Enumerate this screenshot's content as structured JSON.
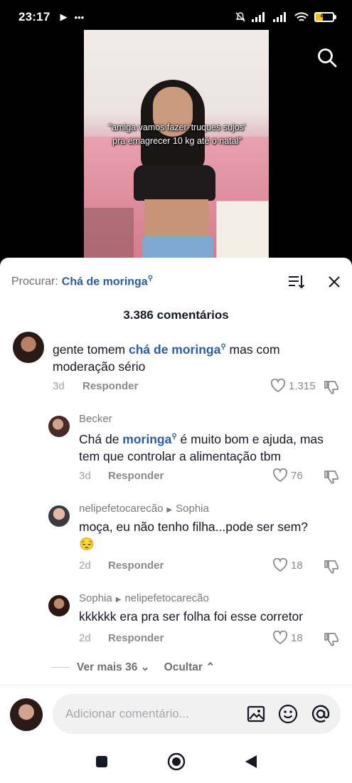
{
  "status_bar": {
    "time": "23:17",
    "left_icons": [
      "play-icon",
      "more-dots-icon"
    ],
    "battery_level": "42",
    "battery_fraction": 0.42,
    "accent": "#f2c200"
  },
  "video": {
    "caption": "\"amiga vamos fazer 'truques sujos' pra emagrecer 10 kg até o natal\""
  },
  "sheet": {
    "search_prefix": "Procurar:",
    "search_term": "Chá de moringa",
    "comment_count": "3.386 comentários"
  },
  "comments": [
    {
      "username": "",
      "text_before": "gente tomem ",
      "link": "chá de moringa",
      "text_after": " mas com moderação sério",
      "age": "3d",
      "reply": "Responder",
      "likes": "1.315"
    },
    {
      "username": "Becker",
      "text_before": "Chá de ",
      "link": "moringa",
      "text_after": " é muito bom e ajuda, mas tem que controlar a alimentação tbm",
      "age": "3d",
      "reply": "Responder",
      "likes": "76"
    },
    {
      "username": "nelipefetocarecão",
      "reply_to": "Sophia",
      "text": "moça, eu não tenho filha...pode ser sem?",
      "emoji": "😔",
      "age": "2d",
      "reply": "Responder",
      "likes": "18"
    },
    {
      "username": "Sophia",
      "reply_to": "nelipefetocarecão",
      "text": "kkkkkk era pra ser folha foi esse corretor",
      "age": "2d",
      "reply": "Responder",
      "likes": "18"
    }
  ],
  "replies_controls": {
    "more": "Ver mais 36",
    "hide": "Ocultar"
  },
  "input": {
    "placeholder": "Adicionar comentário..."
  },
  "colors": {
    "link": "#2b5e9e",
    "text": "#161823",
    "muted": "#8a8a8e"
  }
}
